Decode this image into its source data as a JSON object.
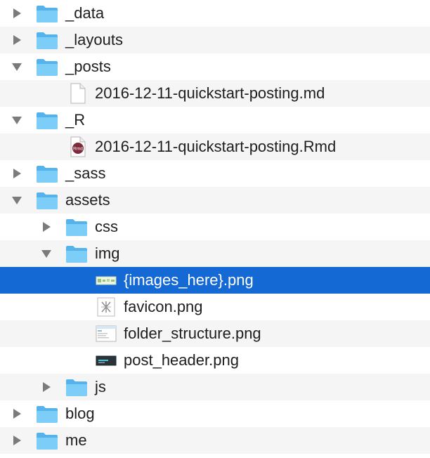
{
  "colors": {
    "selection": "#1469d4",
    "stripe": "#f5f5f5",
    "folder": "#6cc3f3",
    "disclosure": "#7b7b7b"
  },
  "tree": {
    "rows": [
      {
        "label": "_data",
        "icon": "folder-icon",
        "expanded": false
      },
      {
        "label": "_layouts",
        "icon": "folder-icon",
        "expanded": false
      },
      {
        "label": "_posts",
        "icon": "folder-icon",
        "expanded": true
      },
      {
        "label": "2016-12-11-quickstart-posting.md",
        "icon": "markdown-file-icon"
      },
      {
        "label": "_R",
        "icon": "folder-icon",
        "expanded": true
      },
      {
        "label": "2016-12-11-quickstart-posting.Rmd",
        "icon": "rmd-file-icon",
        "badge": "Rmd"
      },
      {
        "label": "_sass",
        "icon": "folder-icon",
        "expanded": false
      },
      {
        "label": "assets",
        "icon": "folder-icon",
        "expanded": true
      },
      {
        "label": "css",
        "icon": "folder-icon",
        "expanded": false
      },
      {
        "label": "img",
        "icon": "folder-icon",
        "expanded": true
      },
      {
        "label": "{images_here}.png",
        "icon": "png-file-icon",
        "selected": true
      },
      {
        "label": "favicon.png",
        "icon": "png-file-icon"
      },
      {
        "label": "folder_structure.png",
        "icon": "png-file-icon"
      },
      {
        "label": "post_header.png",
        "icon": "png-file-icon"
      },
      {
        "label": "js",
        "icon": "folder-icon",
        "expanded": false
      },
      {
        "label": "blog",
        "icon": "folder-icon",
        "expanded": false
      },
      {
        "label": "me",
        "icon": "folder-icon",
        "expanded": false
      }
    ]
  }
}
